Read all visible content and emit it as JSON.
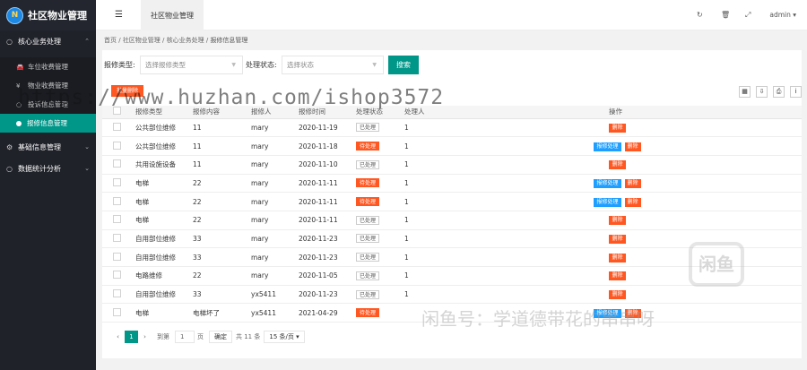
{
  "app": {
    "title": "社区物业管理",
    "logo_text": "N"
  },
  "sidebar": {
    "core": {
      "label": "核心业务处理",
      "items": [
        {
          "label": "车位收费管理",
          "icon": "car-icon"
        },
        {
          "label": "物业收费管理",
          "icon": "money-icon"
        },
        {
          "label": "投诉信息管理",
          "icon": "complaint-icon"
        },
        {
          "label": "报修信息管理",
          "icon": "repair-icon"
        }
      ]
    },
    "basic": {
      "label": "基础信息管理"
    },
    "stats": {
      "label": "数据统计分析"
    }
  },
  "topbar": {
    "tab": "社区物业管理",
    "user": "admin"
  },
  "breadcrumb": {
    "home": "首页",
    "c1": "社区物业管理",
    "c2": "核心业务处理",
    "c3": "报修信息管理"
  },
  "filter": {
    "type_label": "报修类型:",
    "type_placeholder": "选择报修类型",
    "status_label": "处理状态:",
    "status_placeholder": "选择状态",
    "search": "搜索"
  },
  "batch_delete": "批量删除",
  "table": {
    "headers": [
      "报修类型",
      "报修内容",
      "报修人",
      "报修时间",
      "处理状态",
      "处理人",
      "操作"
    ],
    "rows": [
      {
        "type": "公共部位维修",
        "content": "11",
        "person": "mary",
        "date": "2020-11-19",
        "status": "已处理",
        "handler": "1",
        "actions": [
          "删除"
        ]
      },
      {
        "type": "公共部位维修",
        "content": "11",
        "person": "mary",
        "date": "2020-11-18",
        "status": "待处理",
        "handler": "1",
        "actions": [
          "报修处理",
          "删除"
        ]
      },
      {
        "type": "共用设施设备",
        "content": "11",
        "person": "mary",
        "date": "2020-11-10",
        "status": "已处理",
        "handler": "1",
        "actions": [
          "删除"
        ]
      },
      {
        "type": "电梯",
        "content": "22",
        "person": "mary",
        "date": "2020-11-11",
        "status": "待处理",
        "handler": "1",
        "actions": [
          "报修处理",
          "删除"
        ]
      },
      {
        "type": "电梯",
        "content": "22",
        "person": "mary",
        "date": "2020-11-11",
        "status": "待处理",
        "handler": "1",
        "actions": [
          "报修处理",
          "删除"
        ]
      },
      {
        "type": "电梯",
        "content": "22",
        "person": "mary",
        "date": "2020-11-11",
        "status": "已处理",
        "handler": "1",
        "actions": [
          "删除"
        ]
      },
      {
        "type": "自用部位维修",
        "content": "33",
        "person": "mary",
        "date": "2020-11-23",
        "status": "已处理",
        "handler": "1",
        "actions": [
          "删除"
        ]
      },
      {
        "type": "自用部位维修",
        "content": "33",
        "person": "mary",
        "date": "2020-11-23",
        "status": "已处理",
        "handler": "1",
        "actions": [
          "删除"
        ]
      },
      {
        "type": "电路维修",
        "content": "22",
        "person": "mary",
        "date": "2020-11-05",
        "status": "已处理",
        "handler": "1",
        "actions": [
          "删除"
        ]
      },
      {
        "type": "自用部位维修",
        "content": "33",
        "person": "yx5411",
        "date": "2020-11-23",
        "status": "已处理",
        "handler": "1",
        "actions": [
          "删除"
        ]
      },
      {
        "type": "电梯",
        "content": "电梯坏了",
        "person": "yx5411",
        "date": "2021-04-29",
        "status": "待处理",
        "handler": "",
        "actions": [
          "报修处理",
          "删除"
        ]
      }
    ]
  },
  "pager": {
    "current": "1",
    "goto_label": "到第",
    "page_value": "1",
    "page_unit": "页",
    "confirm": "确定",
    "total": "共 11 条",
    "page_size": "15 条/页"
  },
  "watermark": {
    "url": "https://www.huzhan.com/ishop3572",
    "text": "闲鱼号：学道德带花的串串呀",
    "logo": "闲鱼"
  }
}
